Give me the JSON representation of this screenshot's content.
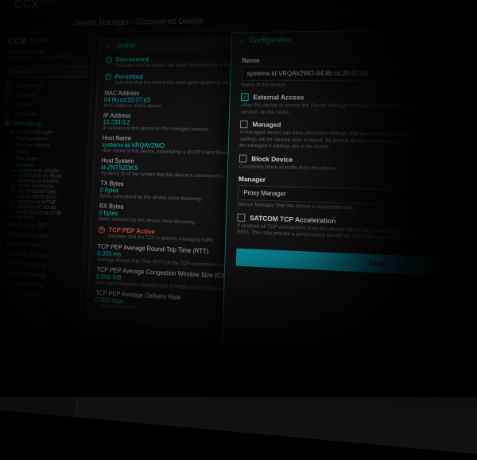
{
  "brand": {
    "main": "CCX",
    "sub": "SYSTEMS"
  },
  "session": {
    "id": "Id-BLDBWQUF",
    "user": "SystemX User",
    "time": "2024-11-14 09:10:20"
  },
  "page_title": "Device Manager - Discovered Device",
  "search": {
    "placeholder": "Search..."
  },
  "top_icons": [
    "flag-icon",
    "chat-icon",
    "bell-icon",
    "user-icon"
  ],
  "nav": {
    "items": [
      {
        "label": "Dashboard"
      },
      {
        "label": "Systems"
      },
      {
        "label": "Security"
      },
      {
        "label": "Interfaces"
      },
      {
        "label": "Networking",
        "active": true
      }
    ],
    "networking_children": [
      {
        "label": "Device Manager",
        "children": [
          {
            "label": "Configuration"
          },
          {
            "label": "Device History"
          },
          {
            "label": "Proxy"
          },
          {
            "label": "Managers"
          },
          {
            "label": "Devices",
            "selected": true
          }
        ]
      }
    ],
    "devices": [
      "systemx-id-VRQAV…",
      "b4b0-b65b:2e-85:84…",
      "systemx-id-EAXFN…",
      "b4:b0-5b:30:b:0e…",
      "ccx-39b65b57d80…",
      "ccx-02:00:00:63:d…",
      "systemx-id-WTMF…",
      "b4:b0-b5:47:b3:4b…",
      "b4:b0:24:b2:ce:c2:db"
    ],
    "add_new": "+ Add New",
    "other": [
      "Per-Device NAT",
      "Routing-Firewall",
      "Local-Firewall",
      "Network Bridges",
      "VRRP Instances",
      "Port Forwarding",
      "IGA Forwarding",
      "DHCP Servers",
      "DNS Servers",
      "Packet Capture",
      "Network Monitor",
      "SATCOM Simulators"
    ]
  },
  "status_panel": {
    "title": "Status",
    "discovered": {
      "title": "Discovered",
      "desc": "Indicates that the device has been discovered on a Manager's configured interface."
    },
    "permitted": {
      "title": "Permitted",
      "desc": "Indicates that the device has been given access to the network it is …"
    },
    "mac": {
      "k": "MAC Address",
      "v": "84:8b:cd:20:07:d3",
      "d": "MAC Address of this device."
    },
    "ip": {
      "k": "IP Address",
      "v": "10.233.0.2",
      "d": "IP Address of this device on the managed network."
    },
    "host": {
      "k": "Host Name",
      "v": "systemx-id-VRQAV2WO",
      "d": "Host Name of this device, provided by a DHCP Client Request (if an…"
    },
    "hostsys": {
      "k": "Host System",
      "v": "id-ZNTSZDKS",
      "d": "SystemX ID of the system that this device is connected to."
    },
    "tx": {
      "k": "TX Bytes",
      "v": "0 bytes",
      "d": "Bytes transmitted by this device since discovery."
    },
    "rx": {
      "k": "RX Bytes",
      "v": "0 bytes",
      "d": "Bytes received by this device since discovery."
    },
    "pep_active": {
      "title": "TCP PEP Active",
      "desc": "Indicates that the TCP is actively managing traffic."
    },
    "rtt": {
      "k": "TCP PEP Average Round-Trip Time (RTT)",
      "v": "0.000 ms",
      "d": "Average Round-Trip Time (RTT) of the TCP connections used by the TCP PEP."
    },
    "cwnd": {
      "k": "TCP PEP Average Congestion Window Size (CWND)",
      "v": "0.000 KiB",
      "d": "Average Congestion Window Size (CWND) of the TCP connections used by the TCP PEP."
    },
    "rate": {
      "k": "TCP PEP Average Delivery Rate",
      "v": "0.000 kbps",
      "d": "… by the TCP PEP."
    }
  },
  "modal": {
    "title": "Configuration",
    "name": {
      "label": "Name",
      "value": "systemx-id-VRQAV2WO-84:8b:cd:20:07:d3",
      "desc": "Name of this device."
    },
    "ext": {
      "label": "External Access",
      "checked": true,
      "desc": "Allow this device to access the Device Manager destination, if disabled but not blocked a device will be able to access services on the router."
    },
    "managed": {
      "label": "Managed",
      "checked": false,
      "desc": "A managed device can have persistent settings, that are stored in a configuration file. If a device isn't managed the settings will be cleared after a reboot. By default all discovered devices are unmanaged, and will have to be configured to be managed if settings are to be stored."
    },
    "block": {
      "label": "Block Device",
      "checked": false,
      "desc": "Completely block all traffic from this device."
    },
    "manager": {
      "label": "Manager",
      "value": "Proxy Manager",
      "desc": "Device Manager that this device is associated with."
    },
    "satcom": {
      "label": "SATCOM TCP Acceleration",
      "checked": false,
      "desc": "If enabled all TCP connections from this device will be transmitted through a TCP Preformance Enhancing Proxy (TCP PEP). This may provide a performance benefit on SATCOM interfaces."
    },
    "save": "Save"
  }
}
